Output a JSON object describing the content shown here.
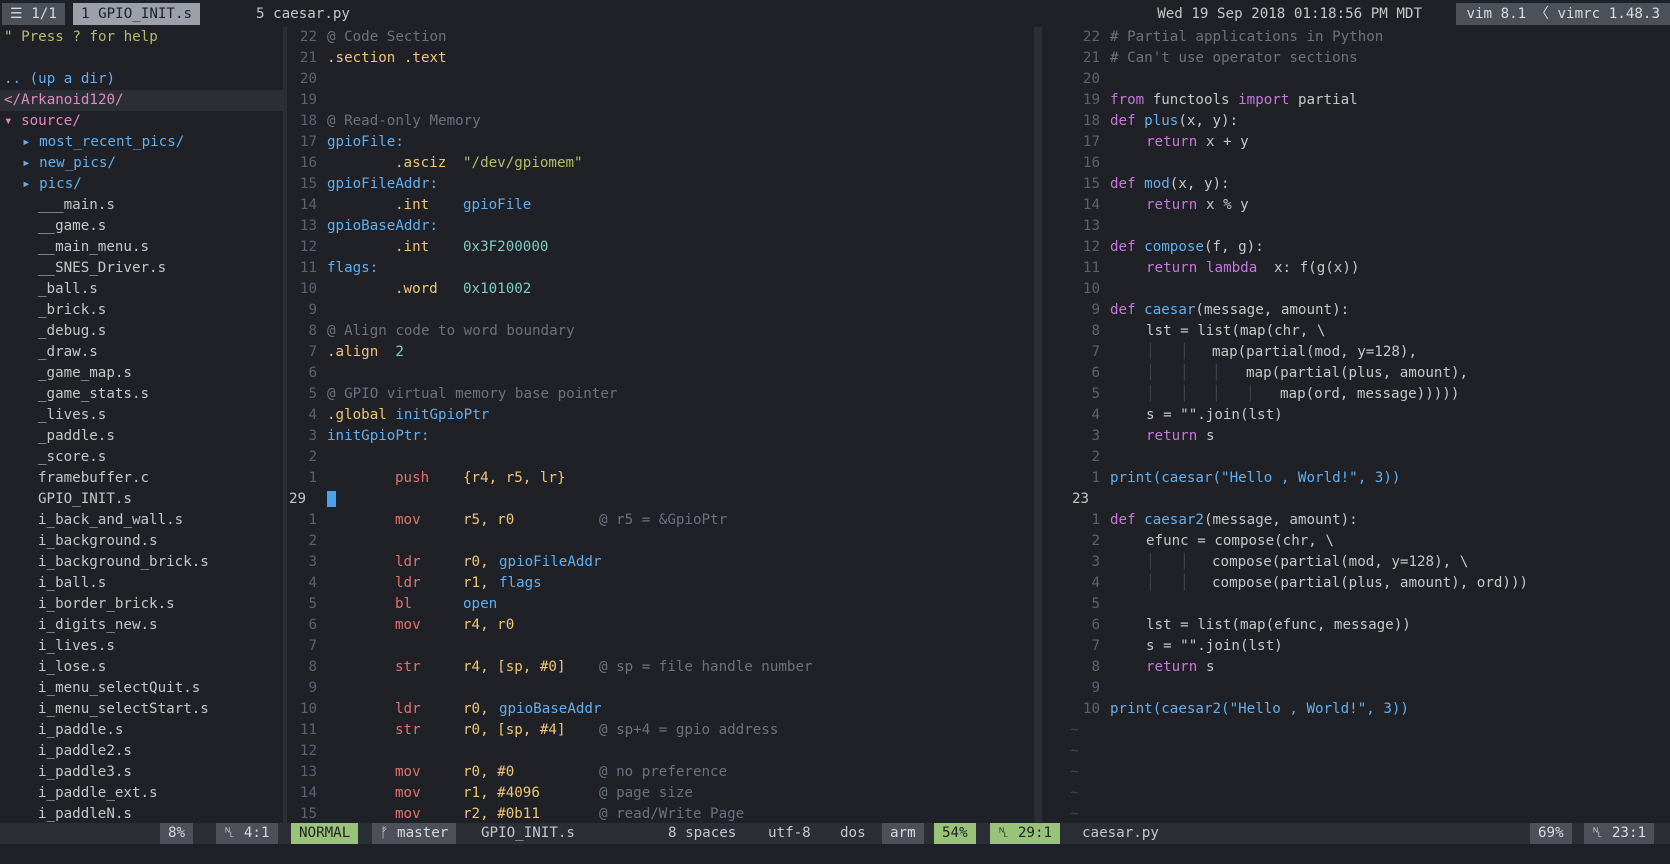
{
  "tabline": {
    "count": "☰ 1/1",
    "active_tab": "1 GPIO_INIT.s",
    "inactive_tab": "5 caesar.py",
    "datetime": "Wed 19 Sep 2018 01:18:56 PM MDT",
    "vim_version": "vim 8.1 〈 vimrc 1.48.3"
  },
  "tree": {
    "help": "\" Press ? for help",
    "up": ".. (up a dir)",
    "root": "</Arkanoid120/",
    "source": "▾ source/",
    "dirs": [
      "▸ most_recent_pics/",
      "▸ new_pics/",
      "▸ pics/"
    ],
    "files": [
      "___main.s",
      "__game.s",
      "__main_menu.s",
      "__SNES_Driver.s",
      "_ball.s",
      "_brick.s",
      "_debug.s",
      "_draw.s",
      "_game_map.s",
      "_game_stats.s",
      "_lives.s",
      "_paddle.s",
      "_score.s",
      "framebuffer.c",
      "GPIO_INIT.s",
      "i_back_and_wall.s",
      "i_background.s",
      "i_background_brick.s",
      "i_ball.s",
      "i_border_brick.s",
      "i_digits_new.s",
      "i_lives.s",
      "i_lose.s",
      "i_menu_selectQuit.s",
      "i_menu_selectStart.s",
      "i_paddle.s",
      "i_paddle2.s",
      "i_paddle3.s",
      "i_paddle_ext.s",
      "i_paddleN.s"
    ]
  },
  "left_pane": {
    "numbers_above": [
      "22",
      "21",
      "20",
      "19",
      "18",
      "17",
      "16",
      "15",
      "14",
      "13",
      "12",
      "11",
      "10",
      "9",
      "8",
      "7",
      "6",
      "5",
      "4",
      "3",
      "2",
      "1"
    ],
    "current_line_number": "29",
    "numbers_below": [
      "1",
      "2",
      "3",
      "4",
      "5",
      "6",
      "7",
      "8",
      "9",
      "10",
      "11",
      "12",
      "13",
      "14",
      "15"
    ],
    "code": {
      "l22": "@ Code Section",
      "l21a": ".section",
      "l21b": ".text",
      "l18": "@ Read-only Memory",
      "l17": "gpioFile:",
      "l16a": ".asciz",
      "l16b": "\"/dev/gpiomem\"",
      "l15": "gpioFileAddr:",
      "l14a": ".int",
      "l14b": "gpioFile",
      "l13": "gpioBaseAddr:",
      "l12a": ".int",
      "l12b": "0x3F200000",
      "l11": "flags:",
      "l10a": ".word",
      "l10b": "0x101002",
      "l8": "@ Align code to word boundary",
      "l7a": ".align",
      "l7b": "2",
      "l5": "@ GPIO virtual memory base pointer",
      "l4a": ".global",
      "l4b": "initGpioPtr",
      "l3": "initGpioPtr:",
      "l1a": "push",
      "l1b": "{r4, r5, lr}",
      "b1a": "mov",
      "b1b": "r5, r0",
      "b1c": "@ r5 = &GpioPtr",
      "b3a": "ldr",
      "b3b": "r0,",
      "b3c": "gpioFileAddr",
      "b4a": "ldr",
      "b4b": "r1,",
      "b4c": "flags",
      "b5a": "bl",
      "b5b": "open",
      "b6a": "mov",
      "b6b": "r4, r0",
      "b8a": "str",
      "b8b": "r4, [sp, #0]",
      "b8c": "@ sp = file handle number",
      "b10a": "ldr",
      "b10b": "r0,",
      "b10c": "gpioBaseAddr",
      "b11a": "str",
      "b11b": "r0, [sp, #4]",
      "b11c": "@ sp+4 = gpio address",
      "b13a": "mov",
      "b13b": "r0, #0",
      "b13c": "@ no preference",
      "b14a": "mov",
      "b14b": "r1, #4096",
      "b14c": "@ page size",
      "b15a": "mov",
      "b15b": "r2, #0b11",
      "b15c": "@ read/Write Page"
    }
  },
  "right_pane": {
    "numbers_above": [
      "22",
      "21",
      "20",
      "19",
      "18",
      "17",
      "16",
      "15",
      "14",
      "13",
      "12",
      "11",
      "10",
      "9",
      "8",
      "7",
      "6",
      "5",
      "4",
      "3",
      "2",
      "1"
    ],
    "current_line_number": "23",
    "numbers_below": [
      "1",
      "2",
      "3",
      "4",
      "5",
      "6",
      "7",
      "8",
      "9",
      "10"
    ],
    "code": {
      "l22": "# Partial applications in Python",
      "l21": "# Can't use operator sections",
      "l19a": "from",
      "l19b": "functools",
      "l19c": "import",
      "l19d": "partial",
      "l18a": "def",
      "l18b": "plus",
      "l18c": "(x, y):",
      "l17a": "return",
      "l17b": "x + y",
      "l15a": "def",
      "l15b": "mod",
      "l15c": "(x, y):",
      "l14a": "return",
      "l14b": "x % y",
      "l12a": "def",
      "l12b": "compose",
      "l12c": "(f, g):",
      "l11a": "return",
      "l11b": "lambda",
      "l11c": "x: f(g(x))",
      "l9a": "def",
      "l9b": "caesar",
      "l9c": "(message, amount):",
      "l8": "lst = list(map(chr, \\",
      "l7": "map(partial(mod, y=128),",
      "l6": "map(partial(plus, amount),",
      "l5": "map(ord, message)))))",
      "l4": "s = \"\".join(lst)",
      "l3a": "return",
      "l3b": "s",
      "l1": "print(caesar(\"Hello , World!\", 3))",
      "b1a": "def",
      "b1b": "caesar2",
      "b1c": "(message, amount):",
      "b2": "efunc = compose(chr, \\",
      "b3": "compose(partial(mod, y=128), \\",
      "b4": "compose(partial(plus, amount), ord)))",
      "b6": "lst = list(map(efunc, message))",
      "b7": "s = \"\".join(lst)",
      "b8a": "return",
      "b8b": "s",
      "b10": "print(caesar2(\"Hello , World!\", 3))"
    }
  },
  "statusline": {
    "tree_percent": "8%",
    "tree_pos": "␤ 4:1",
    "mode": "NORMAL",
    "branch": "ᚠ master",
    "filename": "GPIO_INIT.s",
    "indent": "8 spaces",
    "encoding": "utf-8",
    "format": "dos",
    "filetype": "arm",
    "left_percent": "54%",
    "left_pos": "␤ 29:1",
    "right_filename": "caesar.py",
    "right_percent": "69%",
    "right_pos": "␤ 23:1"
  },
  "colors": {
    "background": "#1f2127",
    "accent_green": "#98c379",
    "comment": "#6b7280",
    "keyword": "#f0c674",
    "label": "#61afef",
    "instruction": "#e0736e",
    "python_keyword": "#c678dd"
  }
}
